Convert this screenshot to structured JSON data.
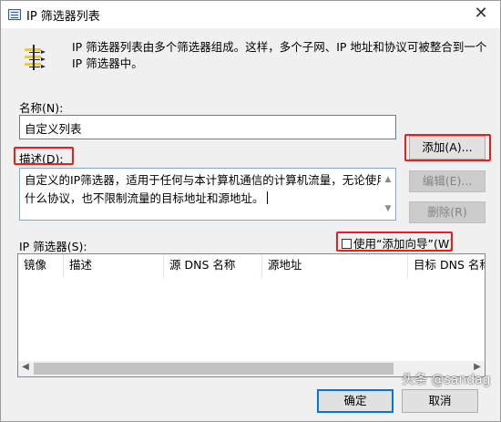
{
  "window": {
    "title": "IP 筛选器列表",
    "close_glyph": "✕"
  },
  "intro": {
    "icon": "filter-list-icon",
    "text": "IP 筛选器列表由多个筛选器组成。这样，多个子网、IP 地址和协议可被整合到一个 IP 筛选器中。"
  },
  "name_field": {
    "label": "名称(N):",
    "value": "自定义列表"
  },
  "description_field": {
    "label": "描述(D):",
    "value": "自定义的IP筛选器，适用于任何与本计算机通信的计算机流量，无论使用什么协议，也不限制流量的目标地址和源地址。"
  },
  "buttons": {
    "add": "添加(A)...",
    "edit": "编辑(E)...",
    "remove": "删除(R)",
    "ok": "确定",
    "cancel": "取消"
  },
  "filters": {
    "label": "IP 筛选器(S):",
    "wizard_checkbox_label": "使用“添加向导”(W)",
    "wizard_checked": false,
    "columns": [
      "镜像",
      "描述",
      "源 DNS 名称",
      "源地址",
      "目标 DNS 名称"
    ],
    "rows": []
  },
  "watermark": "头条 @sandag",
  "colors": {
    "highlight_outline": "#e8201c",
    "focus_border": "#0078d7"
  }
}
